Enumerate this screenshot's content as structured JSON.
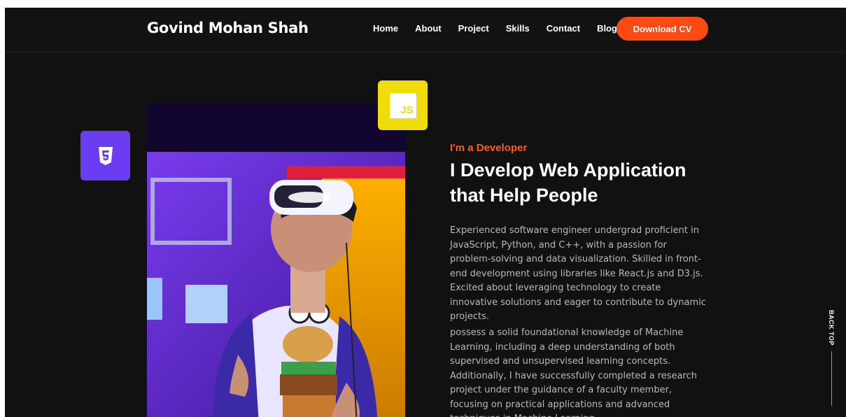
{
  "header": {
    "logo": "Govind Mohan Shah",
    "nav": [
      "Home",
      "About",
      "Project",
      "Skills",
      "Contact",
      "Blog"
    ],
    "cta_label": "Download CV"
  },
  "hero": {
    "eyebrow": "I'm a Developer",
    "headline_line1": "I Develop Web Application",
    "headline_line2": "that Help People",
    "paragraph1": "Experienced software engineer undergrad proficient in JavaScript, Python, and C++, with a passion for problem-solving and data visualization. Skilled in front-end development using libraries like React.js and D3.js. Excited about leveraging technology to create innovative solutions and eager to contribute to dynamic projects.",
    "paragraph2": "possess a solid foundational knowledge of Machine Learning, including a deep understanding of both supervised and unsupervised learning concepts. Additionally, I have successfully completed a research project under the guidance of a faculty member, focusing on practical applications and advanced techniques in Machine Learning.",
    "photo_icon": "person-vr-headset-photo"
  },
  "badges": {
    "css_icon": "css3-icon",
    "js_icon": "javascript-icon",
    "js_label": "JS"
  },
  "back_top": {
    "label": "BACK TOP"
  },
  "colors": {
    "accent": "#ff4a14",
    "background": "#111112",
    "css_badge": "#6a3df3",
    "js_badge": "#f0dc0a"
  }
}
